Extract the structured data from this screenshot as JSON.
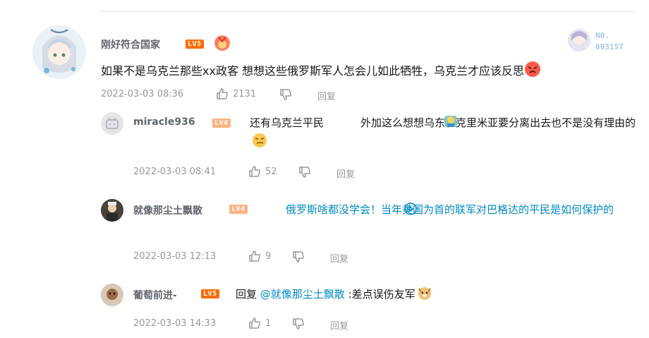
{
  "main_comment": {
    "username": "刚好符合国家",
    "level": "LV5",
    "text": "如果不是乌克兰那些xx政客 想想这些俄罗斯军人怎会儿如此牺牲，乌克兰才应该反思",
    "time": "2022-03-03 08:36",
    "likes": "2131",
    "reply_label": "回复",
    "badge": {
      "line1": "NO.",
      "line2": "003157"
    }
  },
  "replies": [
    {
      "username": "miracle936",
      "level": "LV4",
      "text_a": "还有乌克兰平民",
      "text_b": "外加这么想想乌东和克里米亚要分离出去也不是没有理由的",
      "time": "2022-03-03 08:41",
      "likes": "52",
      "reply_label": "回复"
    },
    {
      "username": "就像那尘土飘散",
      "level": "LV4",
      "link_text": "俄罗斯啥都没学会！当年美国为首的联军对巴格达的平民是如何保护的",
      "time": "2022-03-03 12:13",
      "likes": "9",
      "reply_label": "回复"
    },
    {
      "username": "葡萄前进-",
      "level": "LV5",
      "prefix": "回复",
      "mention": "@就像那尘土飘散",
      "text": ":差点误伤友军",
      "time": "2022-03-03 14:33",
      "likes": "1",
      "reply_label": "回复"
    }
  ],
  "colors": {
    "link": "#008ac5",
    "lv5": "#ff6c00",
    "lv4": "#ffb27f",
    "meta": "#9499a0"
  }
}
